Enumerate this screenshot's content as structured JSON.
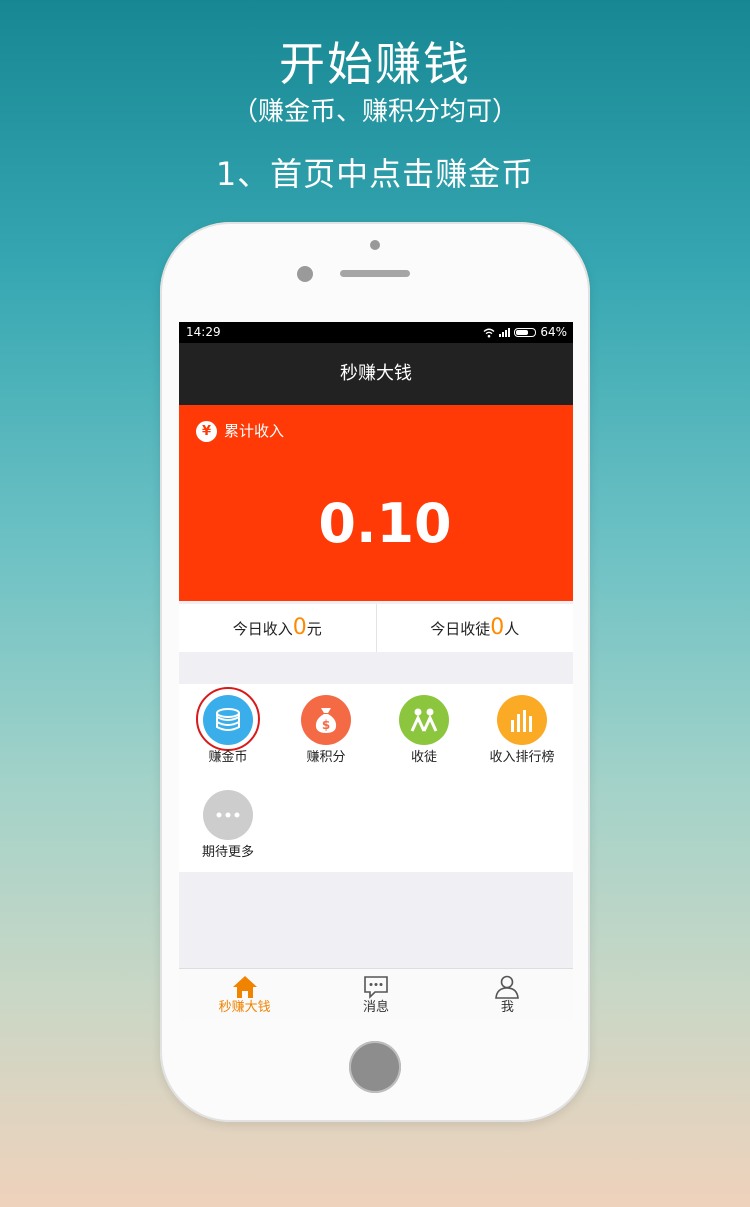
{
  "promo": {
    "title": "开始赚钱",
    "subtitle": "（赚金币、赚积分均可）",
    "step": "1、首页中点击赚金币"
  },
  "status_bar": {
    "time": "14:29",
    "battery": "64%",
    "battery_level": 0.64
  },
  "app": {
    "title": "秒赚大钱"
  },
  "income": {
    "label": "累计收入",
    "value": "0.10",
    "icon": "yen-icon"
  },
  "today": {
    "income_prefix": "今日收入",
    "income_value": "0",
    "income_suffix": "元",
    "apprentice_prefix": "今日收徒",
    "apprentice_value": "0",
    "apprentice_suffix": "人"
  },
  "menu": {
    "items": [
      {
        "label": "赚金币",
        "icon": "coins-icon",
        "color": "#3aaeea",
        "highlighted": true
      },
      {
        "label": "赚积分",
        "icon": "money-bag-icon",
        "color": "#f46a45"
      },
      {
        "label": "收徒",
        "icon": "people-icon",
        "color": "#8cc63e"
      },
      {
        "label": "收入排行榜",
        "icon": "bar-chart-icon",
        "color": "#fbaa26"
      },
      {
        "label": "期待更多",
        "icon": "more-icon",
        "color": "#cdcdcd"
      }
    ]
  },
  "tabbar": {
    "items": [
      {
        "label": "秒赚大钱",
        "icon": "home-icon",
        "active": true
      },
      {
        "label": "消息",
        "icon": "message-icon"
      },
      {
        "label": "我",
        "icon": "user-icon"
      }
    ]
  },
  "colors": {
    "accent_red": "#ff3a07",
    "accent_orange": "#f08300",
    "highlight_ring": "#d91a1a"
  }
}
